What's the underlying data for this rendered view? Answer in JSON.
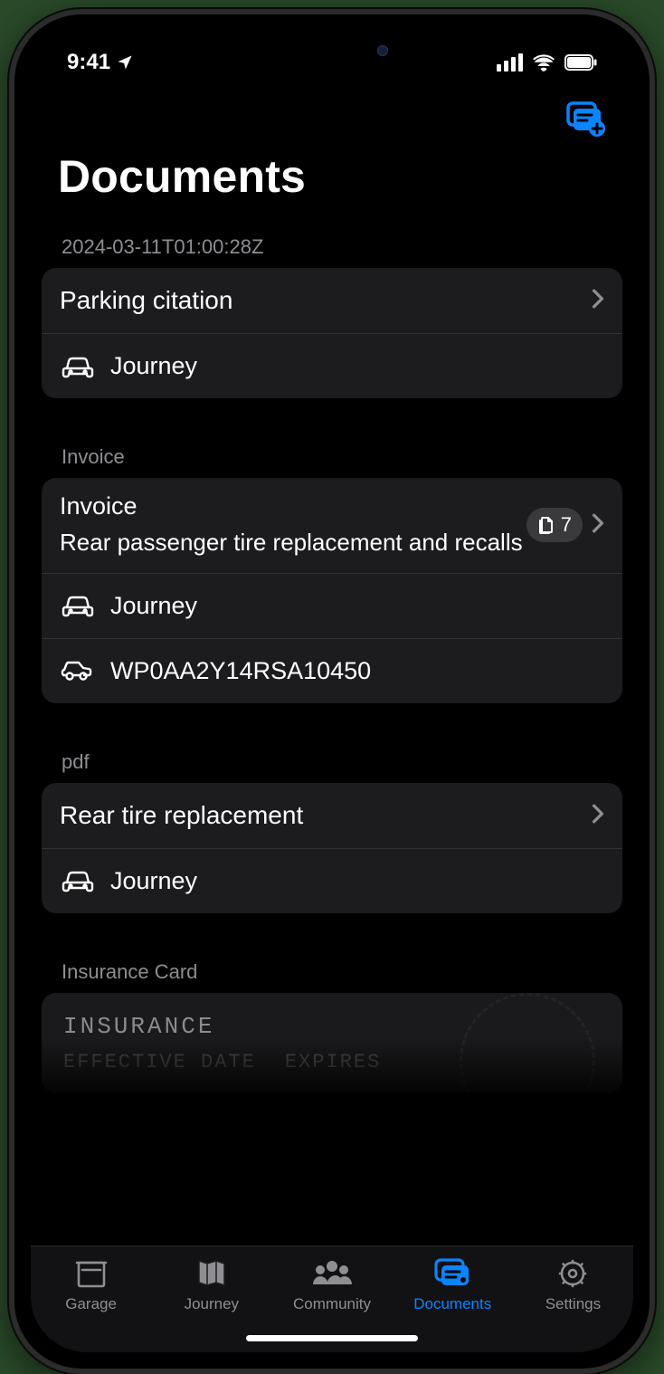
{
  "status": {
    "time": "9:41"
  },
  "header": {
    "title": "Documents"
  },
  "accent_color": "#0a84ff",
  "sections": [
    {
      "label": "2024-03-11T01:00:28Z",
      "primary": "Parking citation",
      "subrows": [
        {
          "icon": "car-front-icon",
          "text": "Journey"
        }
      ]
    },
    {
      "label": "Invoice",
      "primary": "Invoice",
      "description": "Rear passenger tire replacement and recalls",
      "badge_count": "7",
      "subrows": [
        {
          "icon": "car-front-icon",
          "text": "Journey"
        },
        {
          "icon": "car-side-icon",
          "text": "WP0AA2Y14RSA10450"
        }
      ]
    },
    {
      "label": "pdf",
      "primary": "Rear tire replacement",
      "subrows": [
        {
          "icon": "car-front-icon",
          "text": "Journey"
        }
      ]
    },
    {
      "label": "Insurance Card",
      "insurance": {
        "title": "INSURANCE",
        "left": "EFFECTIVE DATE",
        "right": "EXPIRES"
      }
    }
  ],
  "tabs": [
    {
      "label": "Garage",
      "active": false
    },
    {
      "label": "Journey",
      "active": false
    },
    {
      "label": "Community",
      "active": false
    },
    {
      "label": "Documents",
      "active": true
    },
    {
      "label": "Settings",
      "active": false
    }
  ]
}
